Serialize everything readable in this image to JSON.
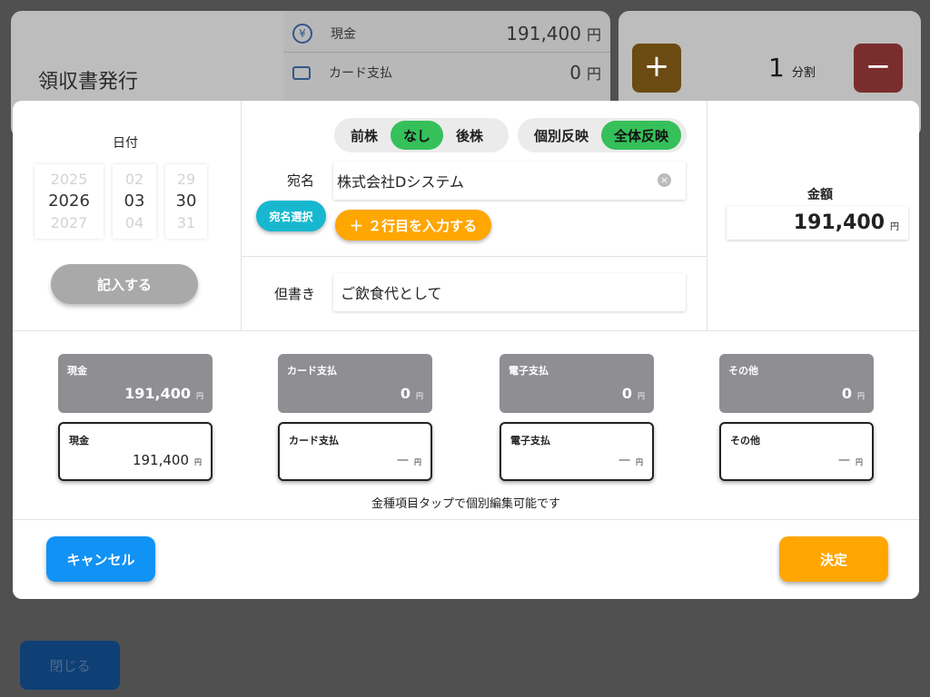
{
  "background": {
    "title": "領収書発行",
    "payments": [
      {
        "icon": "yen-icon",
        "label": "現金",
        "amount": "191,400",
        "unit": "円"
      },
      {
        "icon": "card-icon",
        "label": "カード支払",
        "amount": "0",
        "unit": "円"
      }
    ],
    "plus_label": "+",
    "minus_label": "−",
    "split_count": "1",
    "split_unit": "分割",
    "close_label": "閉じる"
  },
  "dialog": {
    "date": {
      "label": "日付",
      "year": {
        "prev": "2025",
        "selected": "2026",
        "next": "2027"
      },
      "month": {
        "prev": "02",
        "selected": "03",
        "next": "04"
      },
      "day": {
        "prev": "29",
        "selected": "30",
        "next": "31"
      },
      "fill_button": "記入する"
    },
    "honorific": {
      "options": [
        "前株",
        "なし",
        "後株"
      ],
      "selected": "なし"
    },
    "reflect": {
      "options": [
        "個別反映",
        "全体反映"
      ],
      "selected": "全体反映"
    },
    "addressee": {
      "label": "宛名",
      "value": "株式会社Dシステム",
      "clear_icon": "×",
      "select_button": "宛名選択",
      "add_line_button": "＋ ２行目を入力する"
    },
    "remark": {
      "label": "但書き",
      "value": "ご飲食代として"
    },
    "amount": {
      "label": "金額",
      "value": "191,400",
      "unit": "円"
    },
    "tiles_totals": [
      {
        "label": "現金",
        "value": "191,400",
        "unit": "円"
      },
      {
        "label": "カード支払",
        "value": "0",
        "unit": "円"
      },
      {
        "label": "電子支払",
        "value": "0",
        "unit": "円"
      },
      {
        "label": "その他",
        "value": "0",
        "unit": "円"
      }
    ],
    "tiles_edit": [
      {
        "label": "現金",
        "value": "191,400",
        "unit": "円"
      },
      {
        "label": "カード支払",
        "value": "一",
        "unit": "円"
      },
      {
        "label": "電子支払",
        "value": "一",
        "unit": "円"
      },
      {
        "label": "その他",
        "value": "一",
        "unit": "円"
      }
    ],
    "hint": "金種項目タップで個別編集可能です",
    "cancel_button": "キャンセル",
    "confirm_button": "決定"
  },
  "colors": {
    "selected_green": "#35c05a",
    "cyan_button": "#17b8cf",
    "orange_button": "#ffa600",
    "blue_button": "#1192f5",
    "grey_tile": "#8e8e93"
  }
}
